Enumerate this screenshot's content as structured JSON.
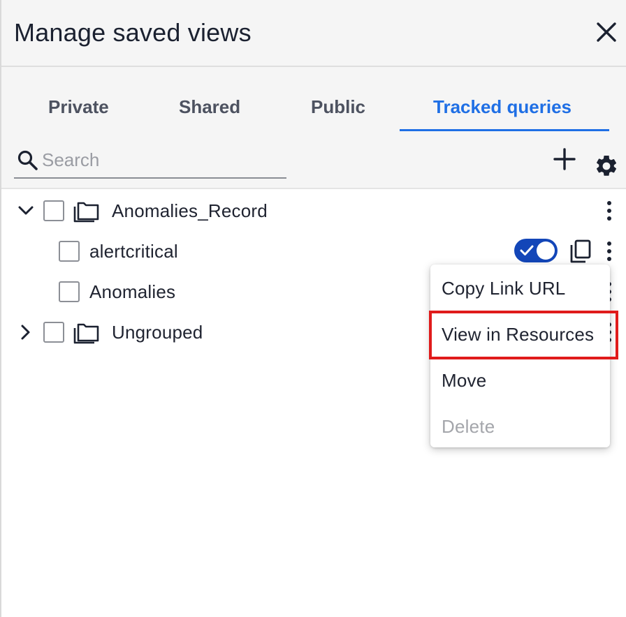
{
  "header": {
    "title": "Manage saved views"
  },
  "tabs": [
    {
      "label": "Private",
      "active": false
    },
    {
      "label": "Shared",
      "active": false
    },
    {
      "label": "Public",
      "active": false
    },
    {
      "label": "Tracked queries",
      "active": true
    }
  ],
  "search": {
    "placeholder": "Search",
    "value": ""
  },
  "tree": {
    "groups": [
      {
        "label": "Anomalies_Record",
        "expanded": true,
        "checked": false,
        "items": [
          {
            "label": "alertcritical",
            "checked": false,
            "toggle_on": true
          },
          {
            "label": "Anomalies",
            "checked": false
          }
        ]
      },
      {
        "label": "Ungrouped",
        "expanded": false,
        "checked": false,
        "items": []
      }
    ]
  },
  "context_menu": {
    "items": [
      {
        "label": "Copy Link URL",
        "disabled": false
      },
      {
        "label": "View in Resources",
        "disabled": false,
        "highlighted": true
      },
      {
        "label": "Move",
        "disabled": false
      },
      {
        "label": "Delete",
        "disabled": true
      }
    ]
  },
  "colors": {
    "accent": "#1f6fe5",
    "toggle": "#1346b8",
    "highlight": "#e01b1b",
    "header_bg": "#f5f5f5"
  },
  "icons": {
    "close": "close-icon",
    "search": "search-icon",
    "add": "plus-icon",
    "settings": "gear-icon",
    "folder": "folder-icon",
    "chevron_down": "chevron-down-icon",
    "chevron_right": "chevron-right-icon",
    "copy": "copy-icon",
    "more": "kebab-icon"
  }
}
